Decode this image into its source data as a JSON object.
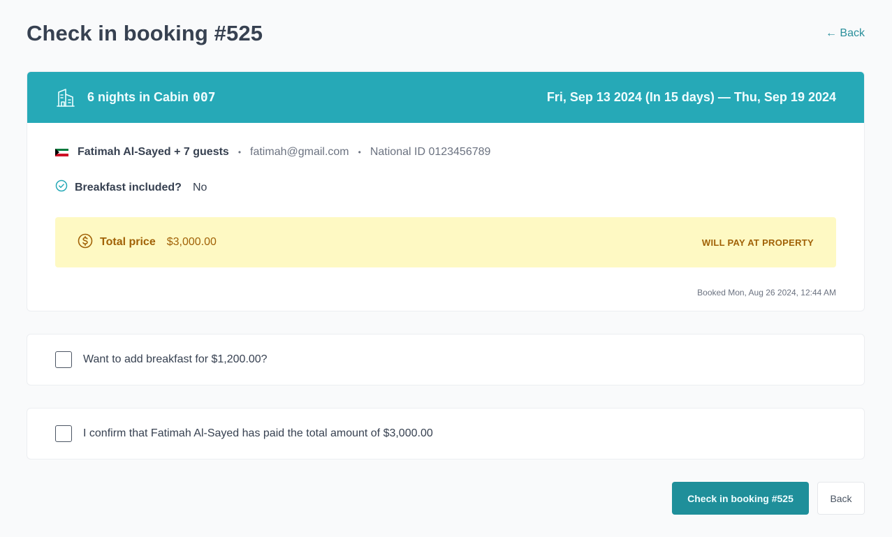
{
  "page": {
    "title": "Check in booking #525",
    "back_link": "← Back"
  },
  "booking": {
    "header_title": "6 nights in Cabin",
    "cabin_number": "007",
    "dates": "Fri, Sep 13 2024 (In 15 days) — Thu, Sep 19 2024",
    "guest_name": "Fatimah Al-Sayed + 7 guests",
    "email": "fatimah@gmail.com",
    "national_id": "National ID 0123456789",
    "breakfast_label": "Breakfast included?",
    "breakfast_value": "No",
    "price_label": "Total price",
    "price_value": "$3,000.00",
    "payment_status": "Will pay at property",
    "booked_at": "Booked Mon, Aug 26 2024, 12:44 AM",
    "separator": "•",
    "flag_icon": "kuwait-flag-icon"
  },
  "options": {
    "add_breakfast_label": "Want to add breakfast for $1,200.00?",
    "confirm_paid_label": "I confirm that Fatimah Al-Sayed has paid the total amount of $3,000.00"
  },
  "actions": {
    "checkin_label": "Check in booking #525",
    "back_label": "Back"
  },
  "colors": {
    "header_bg": "#26a9b7",
    "price_bg": "#fef9c3",
    "price_text": "#a16207",
    "primary_button": "#1f8f9a",
    "link": "#2a8f9b"
  }
}
